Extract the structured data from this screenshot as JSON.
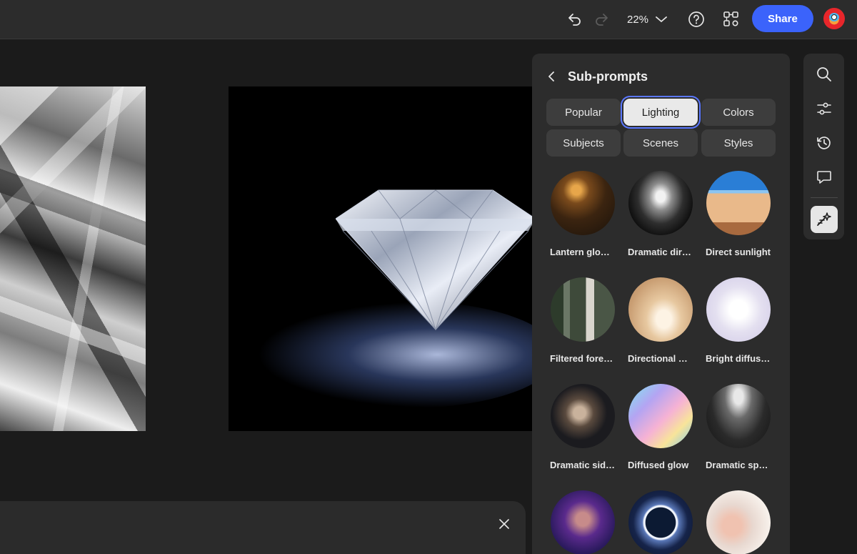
{
  "topbar": {
    "undo_icon": "undo-icon",
    "redo_icon": "redo-icon",
    "zoom_value": "22%",
    "help_icon": "help-icon",
    "settings_icon": "graph-settings-icon",
    "share_label": "Share",
    "accent_color": "#3b63fb"
  },
  "panel": {
    "back_icon": "chevron-left-icon",
    "title": "Sub-prompts",
    "chips": [
      "Popular",
      "Lighting",
      "Colors",
      "Subjects",
      "Scenes",
      "Styles"
    ],
    "selected_chip": "Lighting",
    "tiles": [
      {
        "label": "Lantern glo…"
      },
      {
        "label": "Dramatic dir…"
      },
      {
        "label": "Direct sunlight"
      },
      {
        "label": "Filtered fore…"
      },
      {
        "label": "Directional …"
      },
      {
        "label": "Bright diffus…"
      },
      {
        "label": "Dramatic sid…"
      },
      {
        "label": "Diffused glow"
      },
      {
        "label": "Dramatic sp…"
      },
      {
        "label": ""
      },
      {
        "label": ""
      },
      {
        "label": ""
      }
    ]
  },
  "rail": {
    "icons": [
      "search-icon",
      "adjustments-icon",
      "history-icon",
      "comment-icon",
      "generate-icon"
    ],
    "active": "generate-icon"
  },
  "prompt_bar": {
    "close_icon": "close-icon"
  }
}
